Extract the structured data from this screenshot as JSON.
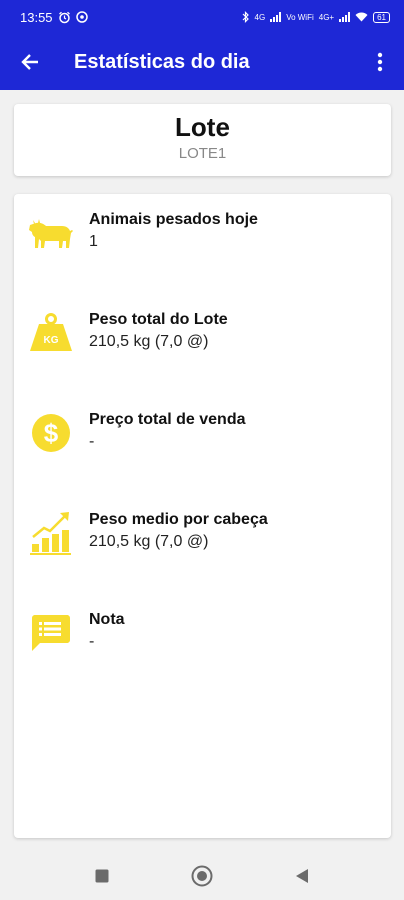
{
  "status_bar": {
    "time": "13:55",
    "network_label_1": "4G",
    "network_label_2": "Vo WiFi",
    "network_label_3": "4G+",
    "battery": "61"
  },
  "app_bar": {
    "title": "Estatísticas do dia",
    "back_icon": "arrow-back-icon",
    "menu_icon": "more-vert-icon"
  },
  "lote": {
    "title": "Lote",
    "code": "LOTE1"
  },
  "stats": [
    {
      "icon": "cow-icon",
      "label": "Animais pesados hoje",
      "value": "1"
    },
    {
      "icon": "kg-weight-icon",
      "label": "Peso total do Lote",
      "value": "210,5 kg (7,0 @)"
    },
    {
      "icon": "dollar-coin-icon",
      "label": "Preço total de venda",
      "value": "-"
    },
    {
      "icon": "bar-chart-growth-icon",
      "label": "Peso medio por cabeça",
      "value": "210,5 kg (7,0 @)"
    },
    {
      "icon": "note-icon",
      "label": "Nota",
      "value": "-"
    }
  ],
  "colors": {
    "primary": "#1e28d6",
    "icon_yellow": "#f7dc2f",
    "background": "#f1f1f1"
  }
}
